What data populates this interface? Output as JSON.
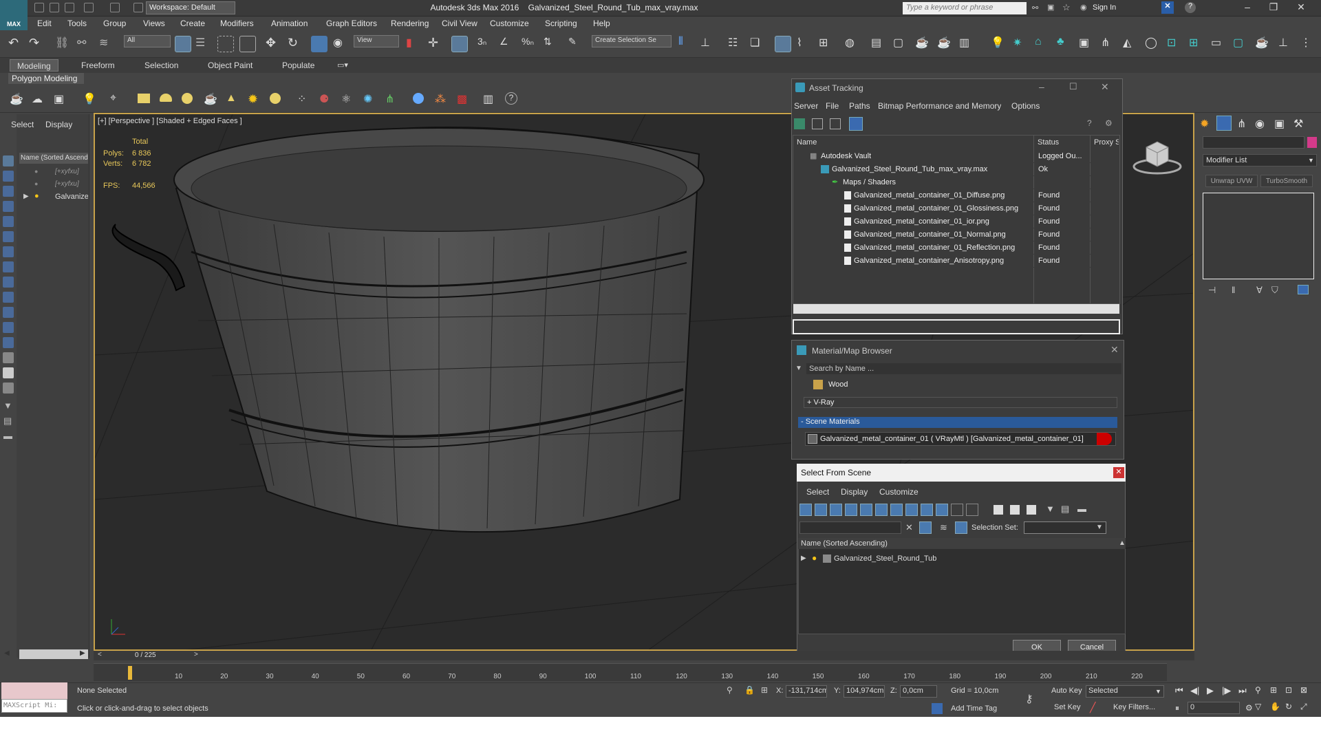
{
  "app": {
    "title": "Autodesk 3ds Max 2016",
    "file": "Galvanized_Steel_Round_Tub_max_vray.max",
    "logo": "MAX",
    "workspace": "Workspace: Default",
    "search_placeholder": "Type a keyword or phrase",
    "sign_in": "Sign In"
  },
  "menu": [
    "Edit",
    "Tools",
    "Group",
    "Views",
    "Create",
    "Modifiers",
    "Animation",
    "Graph Editors",
    "Rendering",
    "Civil View",
    "Customize",
    "Scripting",
    "Help"
  ],
  "toolbar": {
    "filter_value": "All",
    "ref_coord": "View",
    "selection_set": "Create Selection Se"
  },
  "ribbon": {
    "tabs": [
      "Modeling",
      "Freeform",
      "Selection",
      "Object Paint",
      "Populate"
    ],
    "panel_label": "Polygon Modeling"
  },
  "scene_explorer": {
    "tabs": [
      "Select",
      "Display"
    ],
    "column": "Name (Sorted Ascend",
    "items": [
      "[+xyfxu]",
      "[+xyfxu]",
      "Galvanize"
    ],
    "scroll": "0 / 225"
  },
  "viewport": {
    "label": "[+] [Perspective ] [Shaded + Edged Faces ]",
    "stats_header": "Total",
    "polys_label": "Polys:",
    "polys": "6 836",
    "verts_label": "Verts:",
    "verts": "6 782",
    "fps_label": "FPS:",
    "fps": "44,566"
  },
  "asset_tracking": {
    "title": "Asset Tracking",
    "menu": [
      "Server",
      "File",
      "Paths",
      "Bitmap Performance and Memory",
      "Options"
    ],
    "columns": [
      "Name",
      "Status",
      "Proxy S"
    ],
    "rows": [
      {
        "name": "Autodesk Vault",
        "status": "Logged Ou...",
        "indent": 0
      },
      {
        "name": "Galvanized_Steel_Round_Tub_max_vray.max",
        "status": "Ok",
        "indent": 1
      },
      {
        "name": "Maps / Shaders",
        "status": "",
        "indent": 2
      },
      {
        "name": "Galvanized_metal_container_01_Diffuse.png",
        "status": "Found",
        "indent": 3
      },
      {
        "name": "Galvanized_metal_container_01_Glossiness.png",
        "status": "Found",
        "indent": 3
      },
      {
        "name": "Galvanized_metal_container_01_ior.png",
        "status": "Found",
        "indent": 3
      },
      {
        "name": "Galvanized_metal_container_01_Normal.png",
        "status": "Found",
        "indent": 3
      },
      {
        "name": "Galvanized_metal_container_01_Reflection.png",
        "status": "Found",
        "indent": 3
      },
      {
        "name": "Galvanized_metal_container_Anisotropy.png",
        "status": "Found",
        "indent": 3
      }
    ]
  },
  "material_browser": {
    "title": "Material/Map Browser",
    "search": "Search by Name ...",
    "wood": "Wood",
    "vray": "+ V-Ray",
    "scene_materials": "- Scene Materials",
    "material": "Galvanized_metal_container_01  ( VRayMtl )  [Galvanized_metal_container_01]"
  },
  "select_from_scene": {
    "title": "Select From Scene",
    "menu": [
      "Select",
      "Display",
      "Customize"
    ],
    "selection_set_label": "Selection Set:",
    "column": "Name (Sorted Ascending)",
    "item": "Galvanized_Steel_Round_Tub",
    "ok": "OK",
    "cancel": "Cancel"
  },
  "command_panel": {
    "modifier_list": "Modifier List",
    "buttons": [
      "Unwrap UVW",
      "TurboSmooth"
    ]
  },
  "timeline": {
    "ticks": [
      "10",
      "20",
      "30",
      "40",
      "50",
      "60",
      "70",
      "80",
      "90",
      "100",
      "110",
      "120",
      "130",
      "140",
      "150",
      "160",
      "170",
      "180",
      "190",
      "200",
      "210",
      "220"
    ]
  },
  "status": {
    "maxscript": "MAXScript Mi:",
    "none_selected": "None Selected",
    "prompt": "Click or click-and-drag to select objects",
    "x": "-131,714cm",
    "y": "104,974cm",
    "z": "0,0cm",
    "grid": "Grid = 10,0cm",
    "add_time_tag": "Add Time Tag",
    "auto_key": "Auto Key",
    "set_key": "Set Key",
    "selected": "Selected",
    "key_filters": "Key Filters...",
    "frame": "0"
  }
}
